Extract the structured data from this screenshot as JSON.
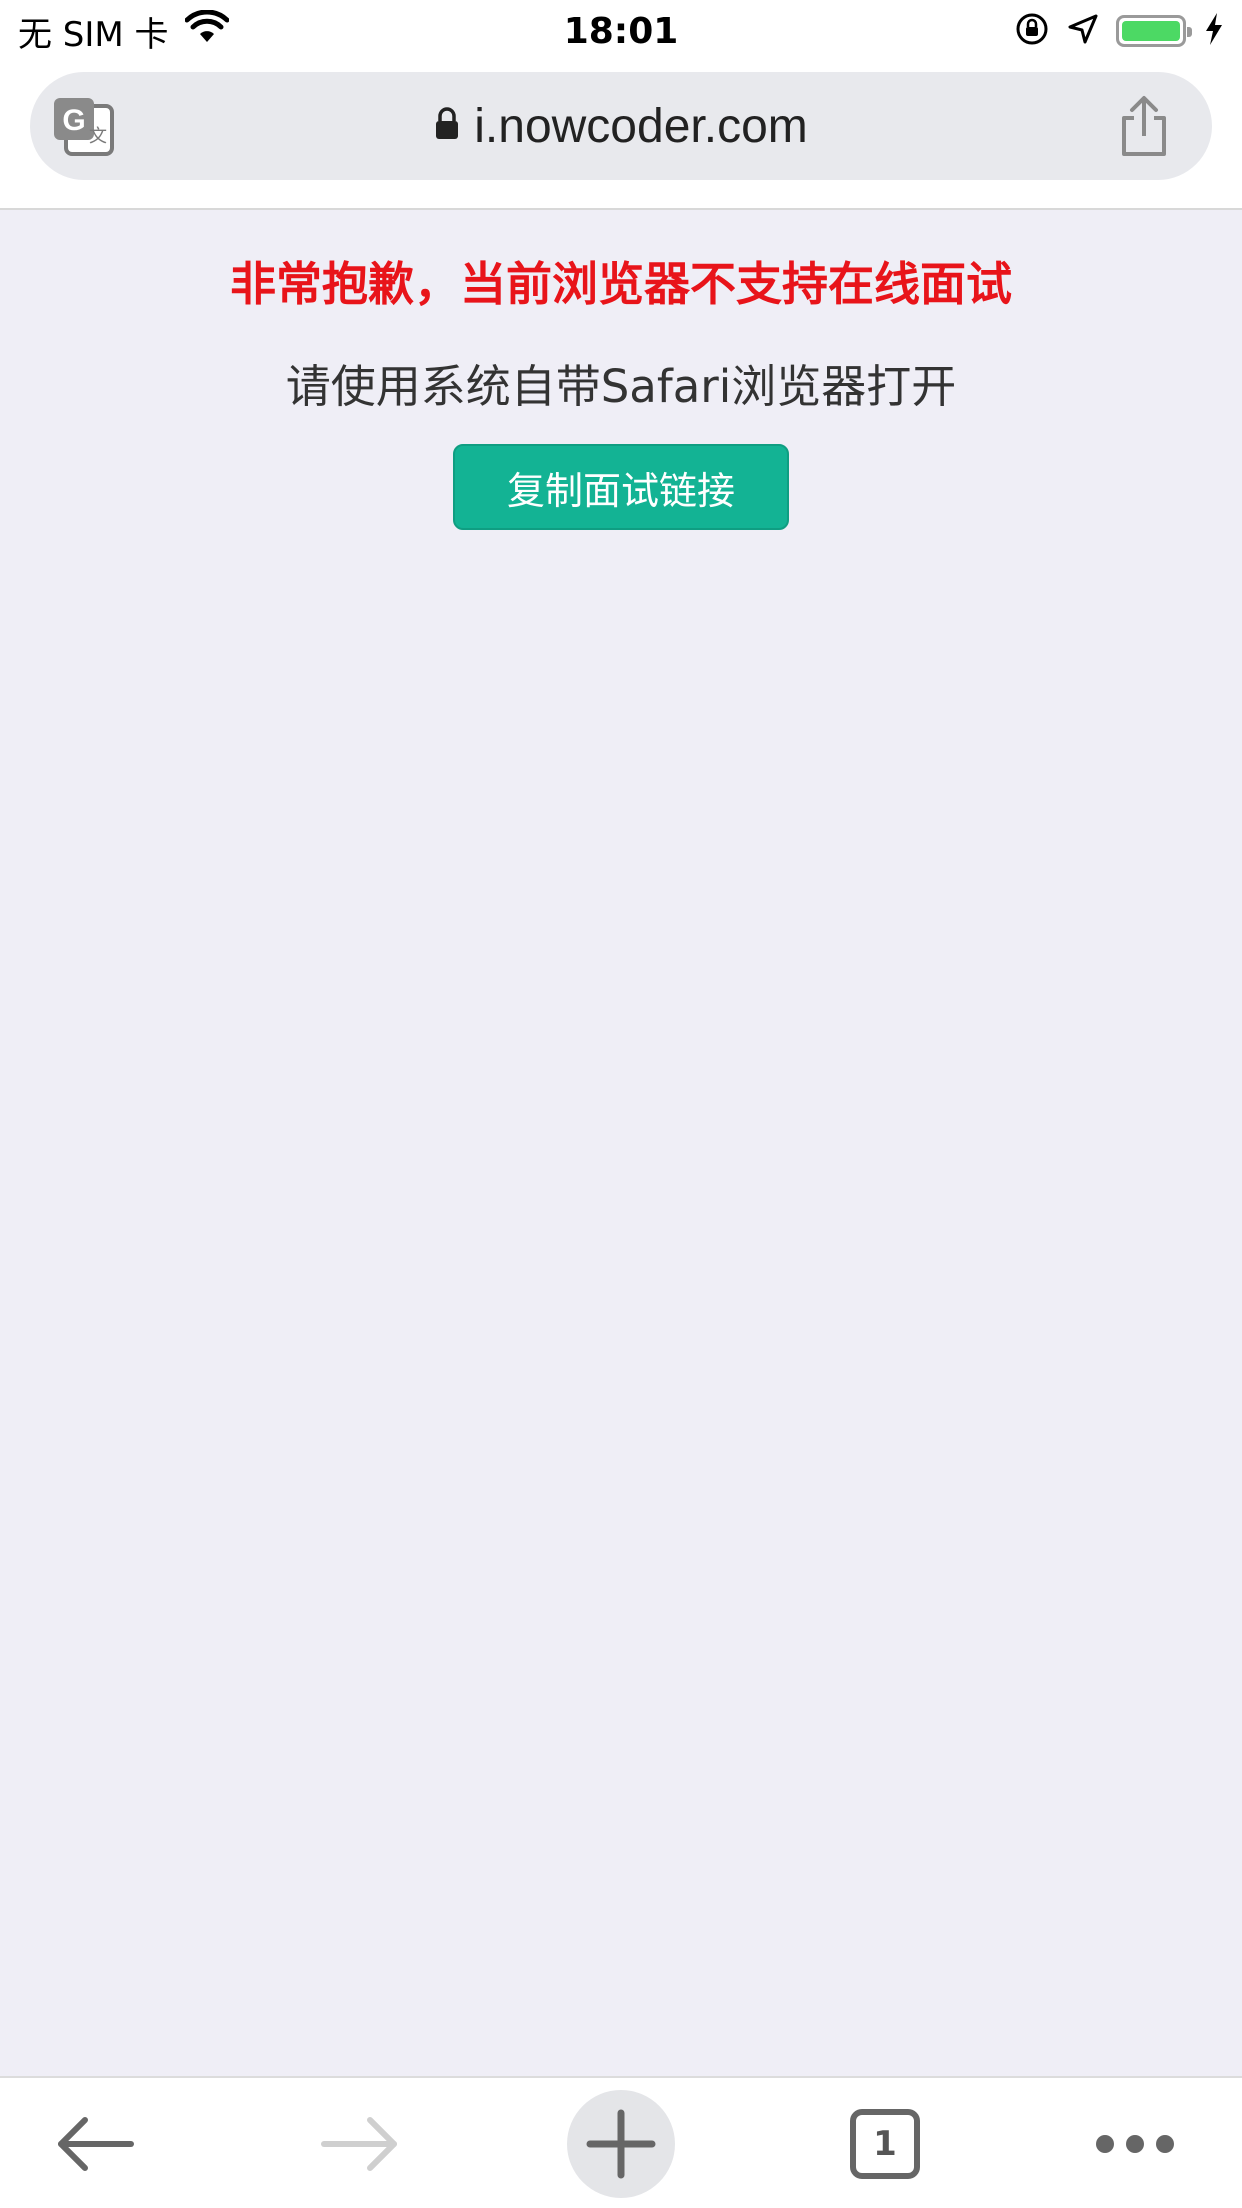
{
  "status_bar": {
    "carrier": "无 SIM 卡",
    "time": "18:01",
    "battery_level": 1.0
  },
  "address_bar": {
    "url": "i.nowcoder.com"
  },
  "content": {
    "warning": "非常抱歉，当前浏览器不支持在线面试",
    "hint": "请使用系统自带Safari浏览器打开",
    "copy_button": "复制面试链接"
  },
  "bottom_bar": {
    "tab_count": "1"
  },
  "colors": {
    "warning": "#e8141a",
    "button": "#13b394",
    "content_bg": "#efeef6"
  }
}
